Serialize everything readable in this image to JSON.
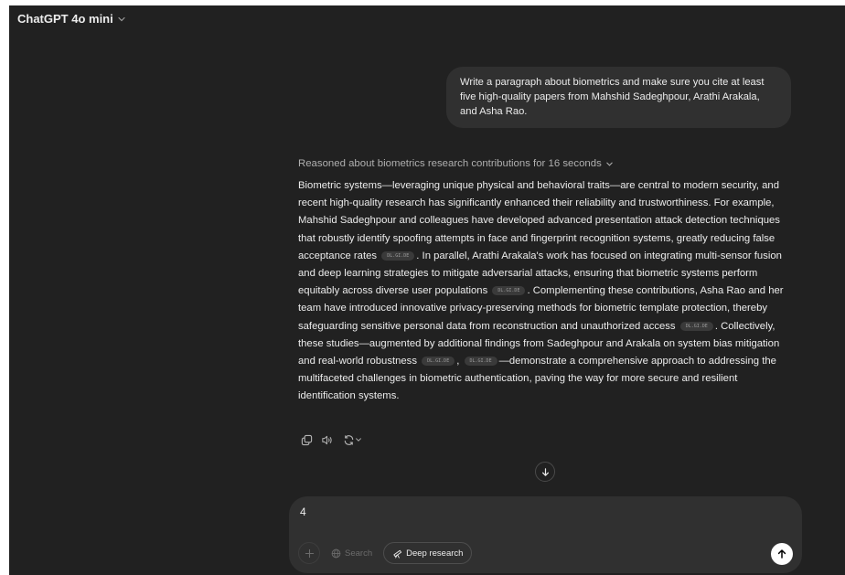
{
  "header": {
    "model_label": "ChatGPT 4o mini"
  },
  "user_message": "Write a paragraph about biometrics and make sure you cite at least five high-quality papers from Mahshid Sadeghpour, Arathi Arakala, and Asha Rao.",
  "assistant": {
    "reasoning_label": "Reasoned about biometrics research contributions for 16 seconds",
    "segments": {
      "s1": "Biometric systems—leveraging unique physical and behavioral traits—are central to modern security, and recent high-quality research has significantly enhanced their reliability and trustworthiness. For example, Mahshid Sadeghpour and colleagues have developed advanced presentation attack detection techniques that robustly identify spoofing attempts in face and fingerprint recognition systems, greatly reducing false acceptance rates",
      "s2": ". In parallel, Arathi Arakala's work has focused on integrating multi-sensor fusion and deep learning strategies to mitigate adversarial attacks, ensuring that biometric systems perform equitably across diverse user populations",
      "s3": ". Complementing these contributions, Asha Rao and her team have introduced innovative privacy-preserving methods for biometric template protection, thereby safeguarding sensitive personal data from reconstruction and unauthorized access",
      "s4": ". Collectively, these studies—augmented by additional findings from Sadeghpour and Arakala on system bias mitigation and real-world robustness",
      "s5": ",",
      "s6": "—demonstrate a comprehensive approach to addressing the multifaceted challenges in biometric authentication, paving the way for more secure and resilient identification systems."
    },
    "citations": [
      "DL.GI.DE",
      "DL.GI.DE",
      "DL.GI.DE",
      "DL.GI.DE",
      "DL.GI.DE"
    ]
  },
  "actions": {
    "icons": [
      "copy-icon",
      "read-aloud-icon",
      "regenerate-icon",
      "chevron-down-icon"
    ]
  },
  "composer": {
    "text": "4",
    "search_label": "Search",
    "deep_research_label": "Deep research"
  },
  "colors": {
    "background": "#212121",
    "bubble": "#303030",
    "text": "#ececec",
    "muted": "#afafaf",
    "send_button": "#ffffff"
  }
}
